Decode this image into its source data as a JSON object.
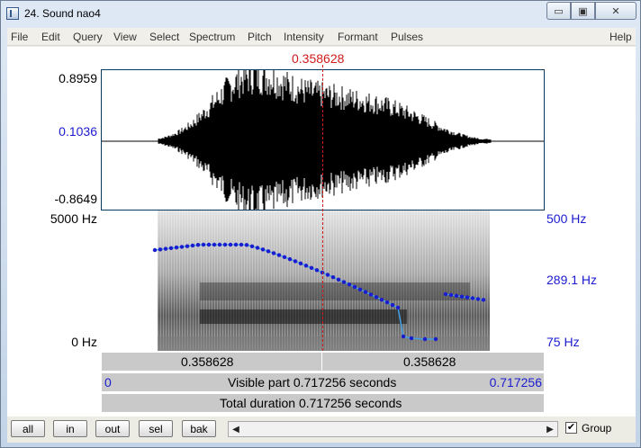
{
  "window": {
    "title": "24. Sound nao4",
    "minimize_glyph": "▭",
    "maximize_glyph": "▣",
    "close_glyph": "✕"
  },
  "menu": {
    "items": [
      "File",
      "Edit",
      "Query",
      "View",
      "Select",
      "Spectrum",
      "Pitch",
      "Intensity",
      "Formant",
      "Pulses"
    ],
    "help": "Help"
  },
  "cursor": {
    "time": "0.358628"
  },
  "waveform": {
    "max_label": "0.8959",
    "zero_label": "0.1036",
    "min_label": "-0.8649"
  },
  "spectrogram": {
    "top_freq_label": "5000 Hz",
    "bottom_freq_label": "0 Hz"
  },
  "pitch": {
    "top_label": "500 Hz",
    "mid_label": "289.1 Hz",
    "bottom_label": "75 Hz",
    "color": "#1b1bd0",
    "line_color": "#3fa0e8"
  },
  "time_bars": {
    "left_segment": "0.358628",
    "right_segment": "0.358628",
    "visible_start": "0",
    "visible_text": "Visible part 0.717256 seconds",
    "visible_end": "0.717256",
    "total_text": "Total duration 0.717256 seconds"
  },
  "buttons": {
    "all": "all",
    "in": "in",
    "out": "out",
    "sel": "sel",
    "bak": "bak"
  },
  "scroll": {
    "left_glyph": "◀",
    "right_glyph": "▶"
  },
  "group": {
    "label": "Group",
    "checked_glyph": "✔"
  }
}
